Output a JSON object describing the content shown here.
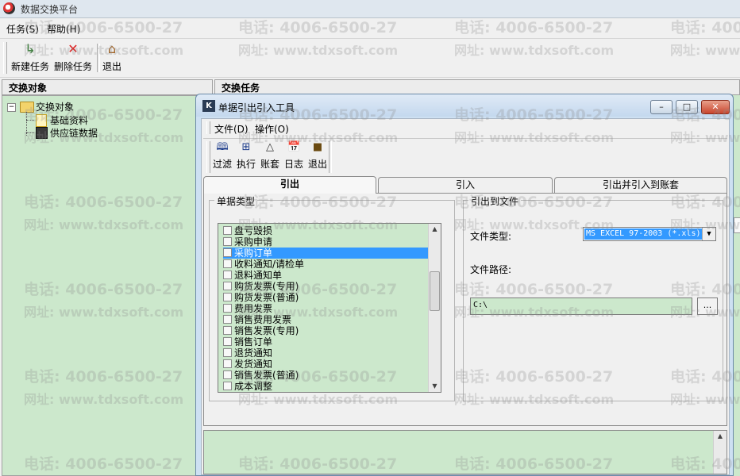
{
  "window": {
    "title": "数据交换平台"
  },
  "menu": {
    "items": [
      "任务(S)",
      "帮助(H)"
    ]
  },
  "toolbar": {
    "new_task": "新建任务",
    "delete_task": "删除任务",
    "exit": "退出"
  },
  "left_panel": {
    "header": "交换对象",
    "tree": {
      "root": "交换对象",
      "children": [
        "基础资料",
        "供应链数据"
      ]
    }
  },
  "right_panel": {
    "header": "交换任务"
  },
  "watermark": {
    "phone": "电话: 4006-6500-27",
    "site": "网址: www.tdxsoft.com"
  },
  "dialog": {
    "title": "单据引出引入工具",
    "menu": [
      "文件(D)",
      "操作(O)"
    ],
    "toolbar": [
      "过滤",
      "执行",
      "账套",
      "日志",
      "退出"
    ],
    "tabs": [
      "引出",
      "引入",
      "引出并引入到账套"
    ],
    "doc_types": {
      "label": "单据类型",
      "items": [
        "盘亏毁损",
        "采购申请",
        "采购订单",
        "收料通知/请检单",
        "退料通知单",
        "购货发票(专用)",
        "购货发票(普通)",
        "费用发票",
        "销售费用发票",
        "销售发票(专用)",
        "销售订单",
        "退货通知",
        "发货通知",
        "销售发票(普通)",
        "成本调整"
      ],
      "selected": "采购订单"
    },
    "export_file": {
      "label": "引出到文件",
      "file_type_label": "文件类型:",
      "file_type_value": "MS EXCEL 97-2003 (*.xls)",
      "file_path_label": "文件路径:",
      "file_path_value": "C:\\",
      "browse_label": "..."
    }
  },
  "colors": {
    "panel_bg": "#cce8cc",
    "selection": "#3399ff",
    "dialog_frame": "#cde0f2"
  },
  "icons": [
    "app-icon",
    "new-task-icon",
    "delete-icon",
    "home-icon",
    "book-icon",
    "run-icon",
    "ledger-icon",
    "calendar-icon",
    "exit-icon"
  ]
}
